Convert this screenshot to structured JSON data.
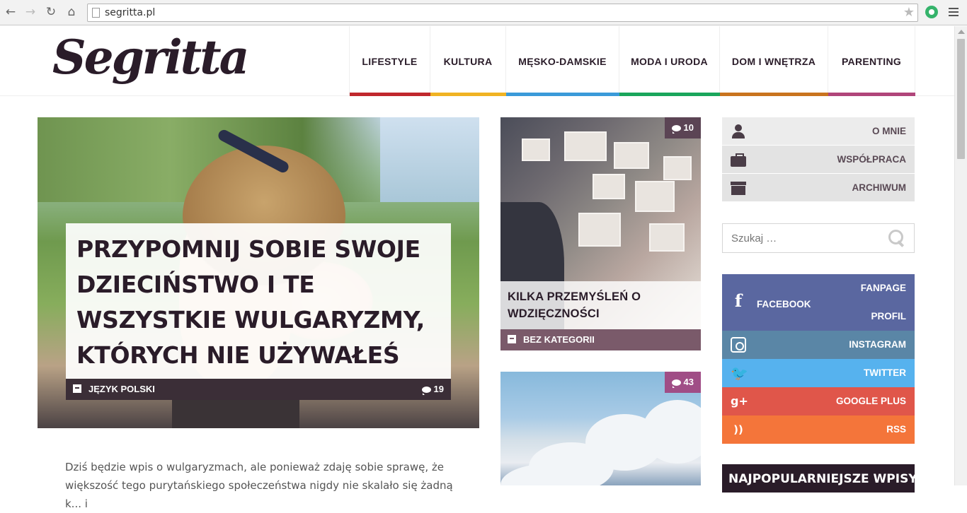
{
  "browser": {
    "url": "segritta.pl",
    "back_icon": "←",
    "forward_icon": "→",
    "reload_icon": "↻",
    "home_icon": "⌂",
    "star_icon": "★"
  },
  "site": {
    "logo": "Segritta"
  },
  "nav": [
    {
      "label": "LIFESTYLE",
      "color": "#c0282d"
    },
    {
      "label": "KULTURA",
      "color": "#f0b323"
    },
    {
      "label": "MĘSKO-DAMSKIE",
      "color": "#3a9ad9"
    },
    {
      "label": "MODA I URODA",
      "color": "#1aa65b"
    },
    {
      "label": "DOM I WNĘTRZA",
      "color": "#c9741f"
    },
    {
      "label": "PARENTING",
      "color": "#b0457a"
    }
  ],
  "feature": {
    "title": "PRZYPOMNIJ SOBIE SWOJE DZIECIŃSTWO I TE WSZYSTKIE WULGARYZMY, KTÓRYCH NIE UŻYWAŁEŚ",
    "category": "JĘZYK POLSKI",
    "comments": "19",
    "excerpt": "Dziś będzie wpis o wulgaryzmach, ale ponieważ zdaję sobie sprawę, że większość tego purytańskiego społeczeństwa nigdy nie skalało się żadną k... i"
  },
  "cards": [
    {
      "title": "KILKA PRZEMYŚLEŃ O WDZIĘCZNOŚCI",
      "category": "BEZ KATEGORII",
      "comments": "10",
      "badge_color": "#5b4454"
    },
    {
      "comments": "43",
      "badge_color": "#a04d86"
    }
  ],
  "sidebar": {
    "links": [
      {
        "label": "O MNIE",
        "icon": "user-icon"
      },
      {
        "label": "WSPÓŁPRACA",
        "icon": "briefcase-icon"
      },
      {
        "label": "ARCHIWUM",
        "icon": "archive-icon"
      }
    ],
    "search_placeholder": "Szukaj …",
    "social": {
      "facebook": {
        "label": "FACEBOOK",
        "fanpage": "FANPAGE",
        "profil": "PROFIL",
        "icon": "f"
      },
      "instagram": {
        "label": "INSTAGRAM"
      },
      "twitter": {
        "label": "TWITTER",
        "icon": "🐦"
      },
      "googleplus": {
        "label": "GOOGLE PLUS",
        "icon": "g+"
      },
      "rss": {
        "label": "RSS",
        "icon": "))"
      }
    },
    "popular_title": "NAJPOPULARNIEJSZE WPISY"
  }
}
